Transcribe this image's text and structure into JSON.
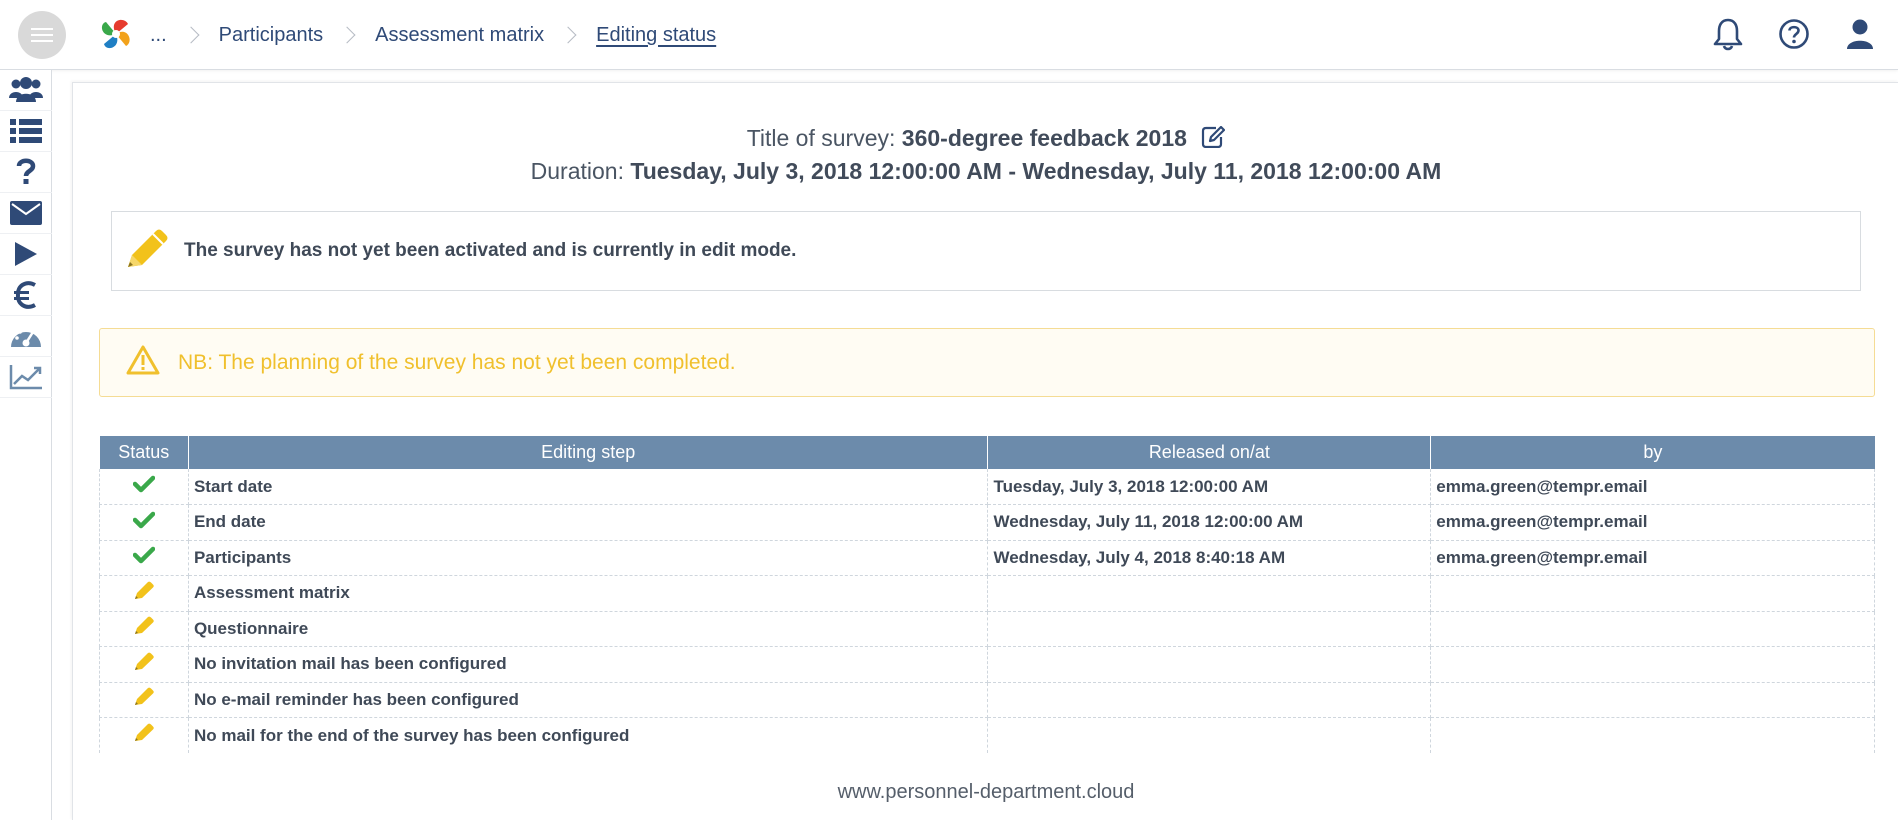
{
  "topbar": {
    "breadcrumb": [
      {
        "label": "..."
      },
      {
        "label": "Participants"
      },
      {
        "label": "Assessment matrix"
      },
      {
        "label": "Editing status"
      }
    ],
    "icons": [
      "bell-icon",
      "help-icon",
      "user-icon"
    ]
  },
  "sidebar": {
    "items": [
      "users-icon",
      "list-icon",
      "question-icon",
      "envelope-icon",
      "play-icon",
      "euro-icon",
      "dashboard-icon",
      "chart-line-icon"
    ]
  },
  "survey": {
    "title_label": "Title of survey:",
    "title_value": "360-degree feedback 2018",
    "duration_label": "Duration:",
    "duration_value": "Tuesday, July 3, 2018 12:00:00 AM - Wednesday, July 11, 2018 12:00:00 AM"
  },
  "edit_notice": "The survey has not yet been activated and is currently in edit mode.",
  "warning": {
    "label": "NB",
    "text": ": The planning of the survey has not yet been completed."
  },
  "table": {
    "headers": [
      "Status",
      "Editing step",
      "Released on/at",
      "by"
    ],
    "rows": [
      {
        "status": "done",
        "step": "Start date",
        "released": "Tuesday, July 3, 2018 12:00:00 AM",
        "by": "emma.green@tempr.email"
      },
      {
        "status": "done",
        "step": "End date",
        "released": "Wednesday, July 11, 2018 12:00:00 AM",
        "by": "emma.green@tempr.email"
      },
      {
        "status": "done",
        "step": "Participants",
        "released": "Wednesday, July 4, 2018 8:40:18 AM",
        "by": "emma.green@tempr.email"
      },
      {
        "status": "edit",
        "step": "Assessment matrix",
        "released": "",
        "by": ""
      },
      {
        "status": "edit",
        "step": "Questionnaire",
        "released": "",
        "by": ""
      },
      {
        "status": "edit",
        "step": "No invitation mail has been configured",
        "released": "",
        "by": ""
      },
      {
        "status": "edit",
        "step": "No e-mail reminder has been configured",
        "released": "",
        "by": ""
      },
      {
        "status": "edit",
        "step": "No mail for the end of the survey has been configured",
        "released": "",
        "by": ""
      }
    ]
  },
  "footer": "www.personnel-department.cloud",
  "colors": {
    "navy": "#2f4a77",
    "header_blue": "#6c8bab",
    "check_green": "#3aa84a",
    "pencil_yellow": "#f2c21b",
    "warning_yellow": "#f0c02d"
  }
}
